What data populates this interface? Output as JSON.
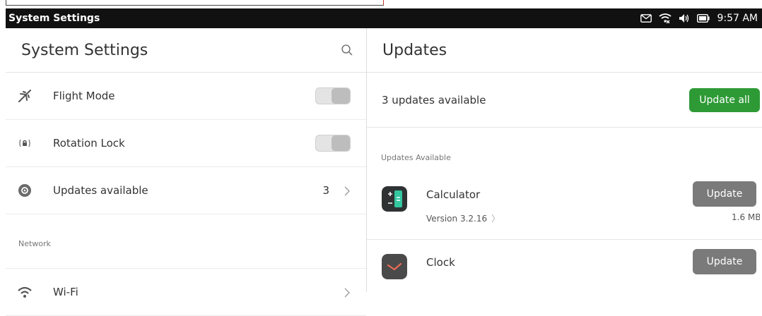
{
  "panel": {
    "app_title": "System Settings",
    "clock": "9:57 AM",
    "indicators": [
      "message-icon",
      "wifi-icon",
      "volume-icon",
      "battery-icon"
    ]
  },
  "left": {
    "title": "System Settings",
    "rows": [
      {
        "label": "Flight Mode",
        "icon": "airplane-icon",
        "control": "toggle",
        "state": "off"
      },
      {
        "label": "Rotation Lock",
        "icon": "rotation-lock-icon",
        "control": "toggle",
        "state": "off"
      },
      {
        "label": "Updates available",
        "icon": "updates-icon",
        "count": "3",
        "control": "chevron"
      }
    ],
    "section_network": "Network",
    "wifi": {
      "label": "Wi-Fi",
      "icon": "wifi-icon"
    }
  },
  "right": {
    "title": "Updates",
    "available_text": "3 updates available",
    "update_all_label": "Update all",
    "section_label": "Updates Available",
    "apps": [
      {
        "name": "Calculator",
        "version": "Version 3.2.16",
        "size": "1.6 MB",
        "button": "Update"
      },
      {
        "name": "Clock",
        "button": "Update"
      }
    ]
  },
  "colors": {
    "panel_bg": "#111111",
    "accent_green": "#2e9a36",
    "update_button": "#7a7a7a",
    "calculator_icon": "#2f3233",
    "calculator_accent": "#33c7a0",
    "clock_icon": "#4a4a4a"
  }
}
